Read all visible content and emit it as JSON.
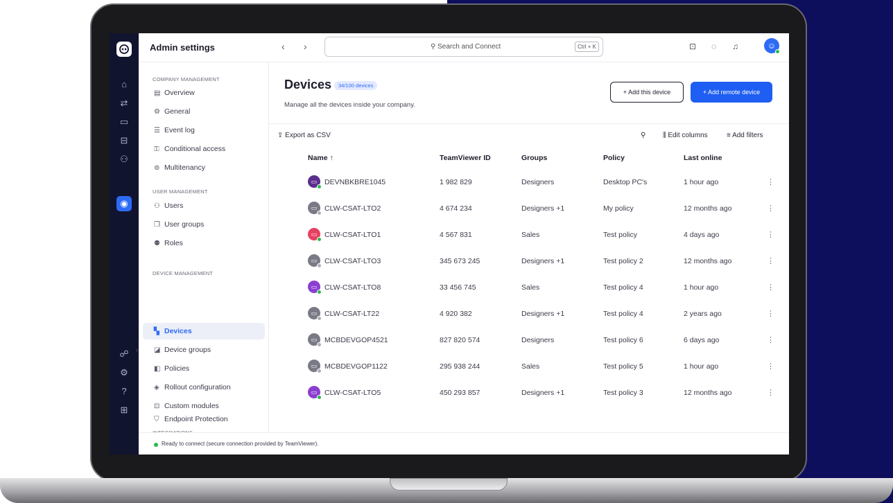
{
  "app": {
    "title": "Admin settings"
  },
  "search": {
    "placeholder": "Search and Connect",
    "shortcut": "Ctrl + K"
  },
  "sidebar": {
    "sections": [
      {
        "label": "COMPANY MANAGEMENT",
        "items": [
          {
            "label": "Overview",
            "icon": "overview-icon"
          },
          {
            "label": "General",
            "icon": "gear-icon"
          },
          {
            "label": "Event log",
            "icon": "log-icon"
          },
          {
            "label": "Conditional access",
            "icon": "access-icon"
          },
          {
            "label": "Multitenancy",
            "icon": "tenancy-icon"
          }
        ]
      },
      {
        "label": "USER MANAGEMENT",
        "items": [
          {
            "label": "Users",
            "icon": "users-icon"
          },
          {
            "label": "User groups",
            "icon": "user-groups-icon"
          },
          {
            "label": "Roles",
            "icon": "roles-icon"
          }
        ]
      },
      {
        "label": "DEVICE MANAGEMENT",
        "items": [
          {
            "label": "Devices",
            "icon": "devices-icon",
            "active": true
          },
          {
            "label": "Device groups",
            "icon": "device-groups-icon"
          },
          {
            "label": "Policies",
            "icon": "policies-icon"
          },
          {
            "label": "Rollout configuration",
            "icon": "rollout-icon"
          },
          {
            "label": "Custom modules",
            "icon": "modules-icon"
          }
        ]
      },
      {
        "label": "INTEGRATIONS",
        "items": [
          {
            "label": "Endpoint Protection",
            "icon": "shield-icon"
          }
        ]
      }
    ]
  },
  "page": {
    "title": "Devices",
    "badge": "34/100 devices",
    "subtitle": "Manage all the devices inside your company.",
    "add_this": "+ Add this device",
    "add_remote": "+ Add remote device"
  },
  "toolbar": {
    "export": "Export as CSV",
    "edit_columns": "Edit columns",
    "add_filters": "Add filters"
  },
  "table": {
    "columns": [
      "Name ↑",
      "TeamViewer ID",
      "Groups",
      "Policy",
      "Last online"
    ],
    "rows": [
      {
        "name": "DEVNBKBRE1045",
        "id": "1 982 829",
        "groups": "Designers",
        "policy": "Desktop PC's",
        "last": "1 hour ago",
        "icon_color": "#5b2d8e",
        "status": "#2bbb4c"
      },
      {
        "name": "CLW-CSAT-LTO2",
        "id": "4 674 234",
        "groups": "Designers +1",
        "policy": "My policy",
        "last": "12 months ago",
        "icon_color": "#7a7a86",
        "status": "#b0b0b8"
      },
      {
        "name": "CLW-CSAT-LTO1",
        "id": "4 567 831",
        "groups": "Sales",
        "policy": "Test policy",
        "last": "4 days ago",
        "icon_color": "#e64060",
        "status": "#2bbb4c"
      },
      {
        "name": "CLW-CSAT-LTO3",
        "id": "345 673 245",
        "groups": "Designers +1",
        "policy": "Test policy 2",
        "last": "12 months ago",
        "icon_color": "#7a7a86",
        "status": "#b0b0b8"
      },
      {
        "name": "CLW-CSAT-LTO8",
        "id": "33 456 745",
        "groups": "Sales",
        "policy": "Test policy 4",
        "last": "1 hour ago",
        "icon_color": "#8b3fd0",
        "status": "#2bbb4c"
      },
      {
        "name": "CLW-CSAT-LT22",
        "id": "4 920 382",
        "groups": "Designers +1",
        "policy": "Test policy 4",
        "last": "2 years ago",
        "icon_color": "#7a7a86",
        "status": "#b0b0b8"
      },
      {
        "name": "MCBDEVGOP4521",
        "id": "827 820 574",
        "groups": "Designers",
        "policy": "Test policy 6",
        "last": "6 days ago",
        "icon_color": "#7a7a86",
        "status": "#b0b0b8"
      },
      {
        "name": "MCBDEVGOP1122",
        "id": "295 938 244",
        "groups": "Sales",
        "policy": "Test policy 5",
        "last": "1 hour ago",
        "icon_color": "#7a7a86",
        "status": "#b0b0b8"
      },
      {
        "name": "CLW-CSAT-LTO5",
        "id": "450 293 857",
        "groups": "Designers +1",
        "policy": "Test policy 3",
        "last": "12 months ago",
        "icon_color": "#8b3fd0",
        "status": "#2bbb4c"
      }
    ]
  },
  "status": {
    "text": "Ready to connect (secure connection provided by TeamViewer)."
  }
}
